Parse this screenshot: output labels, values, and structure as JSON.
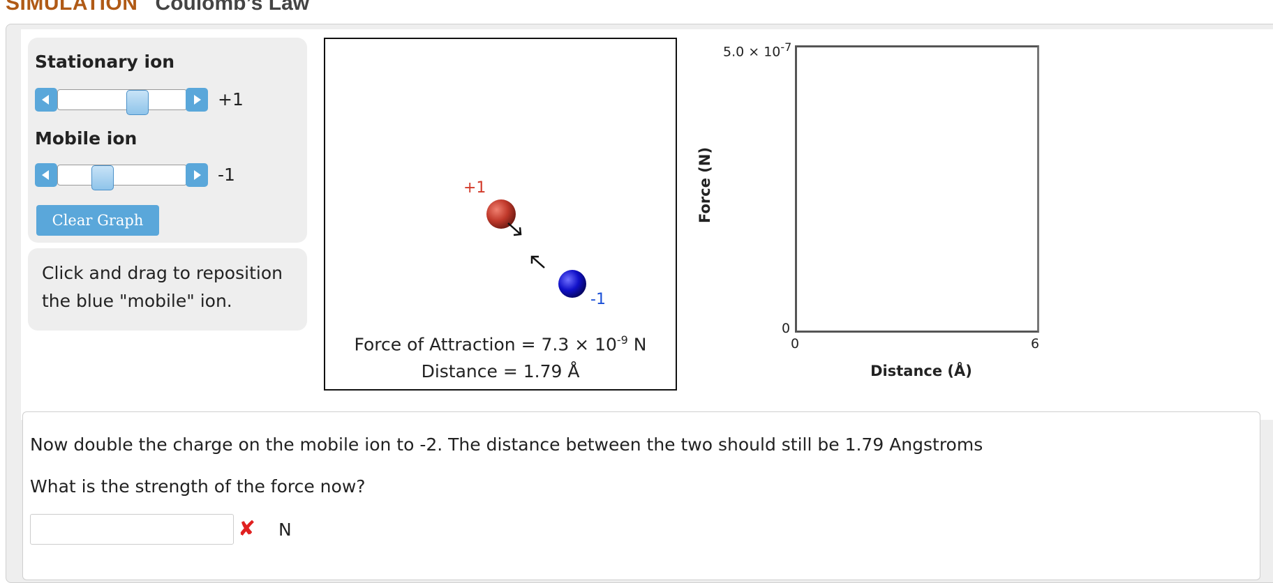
{
  "header": {
    "section": "SIMULATION",
    "title": "Coulomb’s Law"
  },
  "controls": {
    "stationary_label": "Stationary ion",
    "stationary_value": "+1",
    "mobile_label": "Mobile ion",
    "mobile_value": "-1",
    "clear_label": "Clear Graph"
  },
  "hint": "Click and drag to reposition the blue \"mobile\" ion.",
  "simulation": {
    "stationary_charge": "+1",
    "mobile_charge": "-1",
    "force_prefix": "Force of Attraction = 7.3 × 10",
    "force_exponent": "-9",
    "force_unit": " N",
    "distance_text": "Distance = 1.79 Å"
  },
  "graph": {
    "y_max_prefix": "5.0 × 10",
    "y_max_exponent": "-7",
    "y_min": "0",
    "x_min": "0",
    "x_max": "6",
    "y_label": "Force (N)",
    "x_label": "Distance (Å)"
  },
  "question": {
    "line1": "Now double the charge on the mobile ion to -2. The distance between the two should still be 1.79 Angstroms",
    "line2": "What is the strength of the force now?",
    "answer_value": "",
    "unit": "N"
  },
  "colors": {
    "accent": "#5aa7da",
    "title_brand": "#b05a16",
    "stationary_ion": "#c0392b",
    "mobile_ion": "#1010c8",
    "error": "#e02020"
  }
}
